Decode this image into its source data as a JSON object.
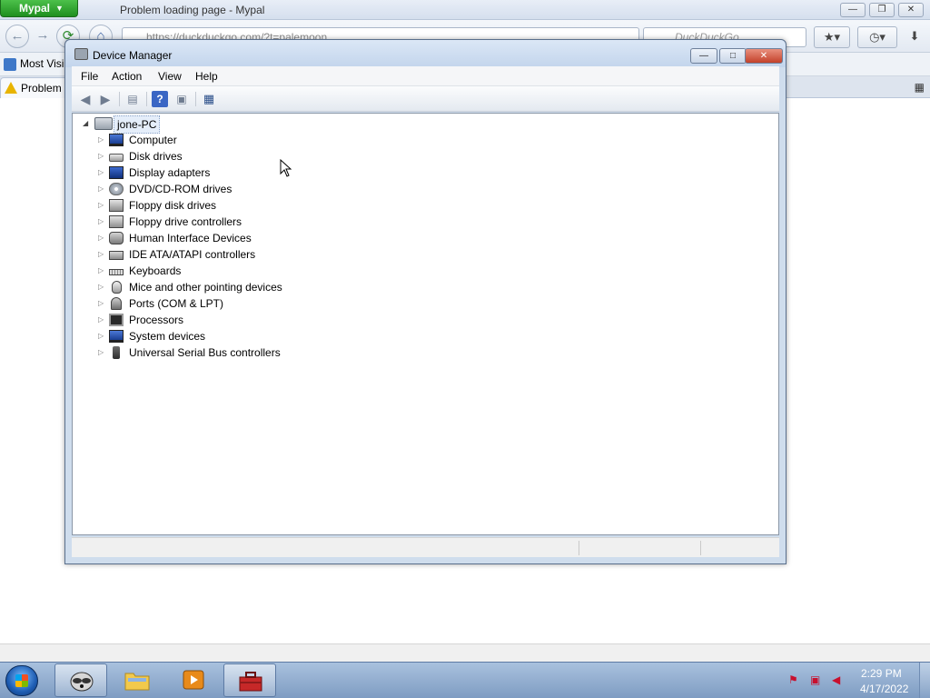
{
  "browser": {
    "menu_button": "Mypal",
    "title": "Problem loading page - Mypal",
    "url": "https://duckduckgo.com/?t=palemoon",
    "search_placeholder": "DuckDuckGo",
    "bookmark_most_visited": "Most Visi",
    "tab_label": "Problem"
  },
  "window": {
    "title": "Device Manager",
    "menu": [
      "File",
      "Action",
      "View",
      "Help"
    ]
  },
  "tree": {
    "root": "jone-PC",
    "items": [
      {
        "label": "Computer",
        "icon": "computer-icon"
      },
      {
        "label": "Disk drives",
        "icon": "disk-drive-icon"
      },
      {
        "label": "Display adapters",
        "icon": "display-adapter-icon"
      },
      {
        "label": "DVD/CD-ROM drives",
        "icon": "dvd-drive-icon"
      },
      {
        "label": "Floppy disk drives",
        "icon": "floppy-drive-icon"
      },
      {
        "label": "Floppy drive controllers",
        "icon": "floppy-controller-icon"
      },
      {
        "label": "Human Interface Devices",
        "icon": "hid-icon"
      },
      {
        "label": "IDE ATA/ATAPI controllers",
        "icon": "ide-controller-icon"
      },
      {
        "label": "Keyboards",
        "icon": "keyboard-icon"
      },
      {
        "label": "Mice and other pointing devices",
        "icon": "mouse-icon"
      },
      {
        "label": "Ports (COM & LPT)",
        "icon": "port-icon"
      },
      {
        "label": "Processors",
        "icon": "processor-icon"
      },
      {
        "label": "System devices",
        "icon": "system-device-icon"
      },
      {
        "label": "Universal Serial Bus controllers",
        "icon": "usb-icon"
      }
    ]
  },
  "taskbar": {
    "time": "2:29 PM",
    "date": "4/17/2022"
  },
  "colors": {
    "mypal_green": "#2a9f2a",
    "selection": "#e5eefa",
    "taskbar": "#8fabcf"
  }
}
